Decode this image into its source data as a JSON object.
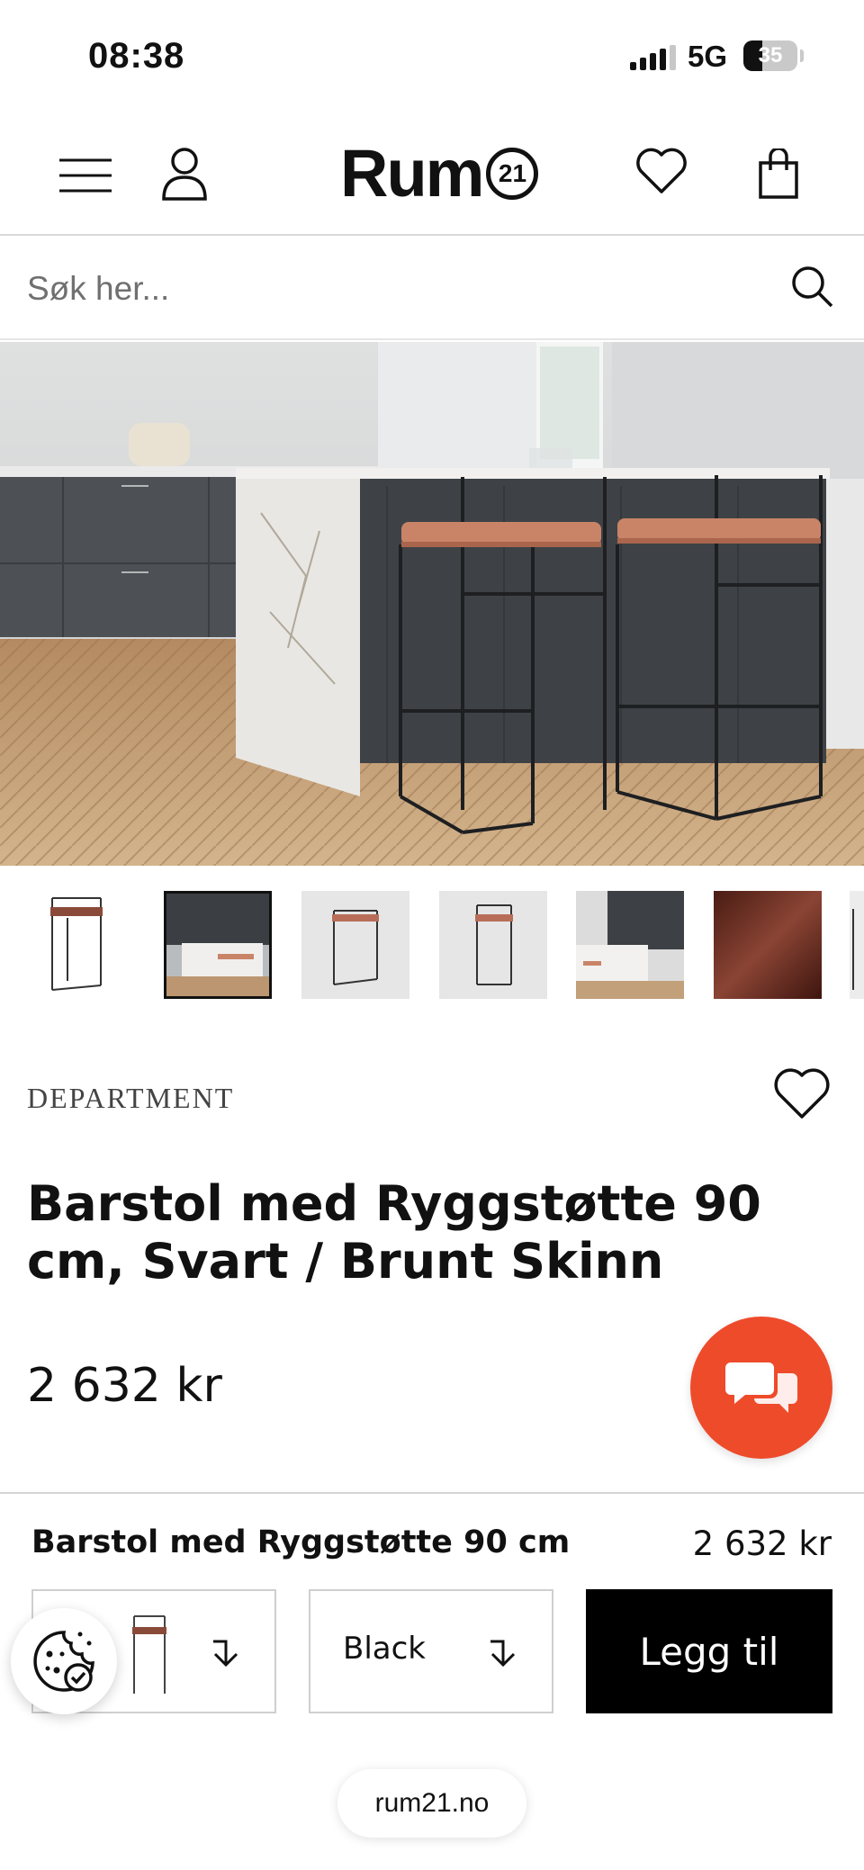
{
  "status_bar": {
    "time": "08:38",
    "network": "5G",
    "battery": "35",
    "battery_level": 0.35
  },
  "header": {
    "logo_text": "Rum",
    "logo_badge": "21"
  },
  "search": {
    "placeholder": "Søk her..."
  },
  "gallery": {
    "thumbnails": [
      "chair-front",
      "kitchen-scene",
      "chair-angle",
      "chair-side",
      "kitchen-wide",
      "leather-swatch"
    ],
    "active_index": 1
  },
  "product": {
    "brand": "DEPARTMENT",
    "title": "Barstol med Ryggstøtte 90 cm, Svart / Brunt Skinn",
    "price": "2 632 kr"
  },
  "sticky_bar": {
    "name": "Barstol med Ryggstøtte 90 cm",
    "price": "2 632 kr",
    "color_value": "Black",
    "add_label": "Legg til"
  },
  "browser": {
    "url": "rum21.no"
  },
  "colors": {
    "accent": "#ee4b2b",
    "button": "#000000"
  }
}
